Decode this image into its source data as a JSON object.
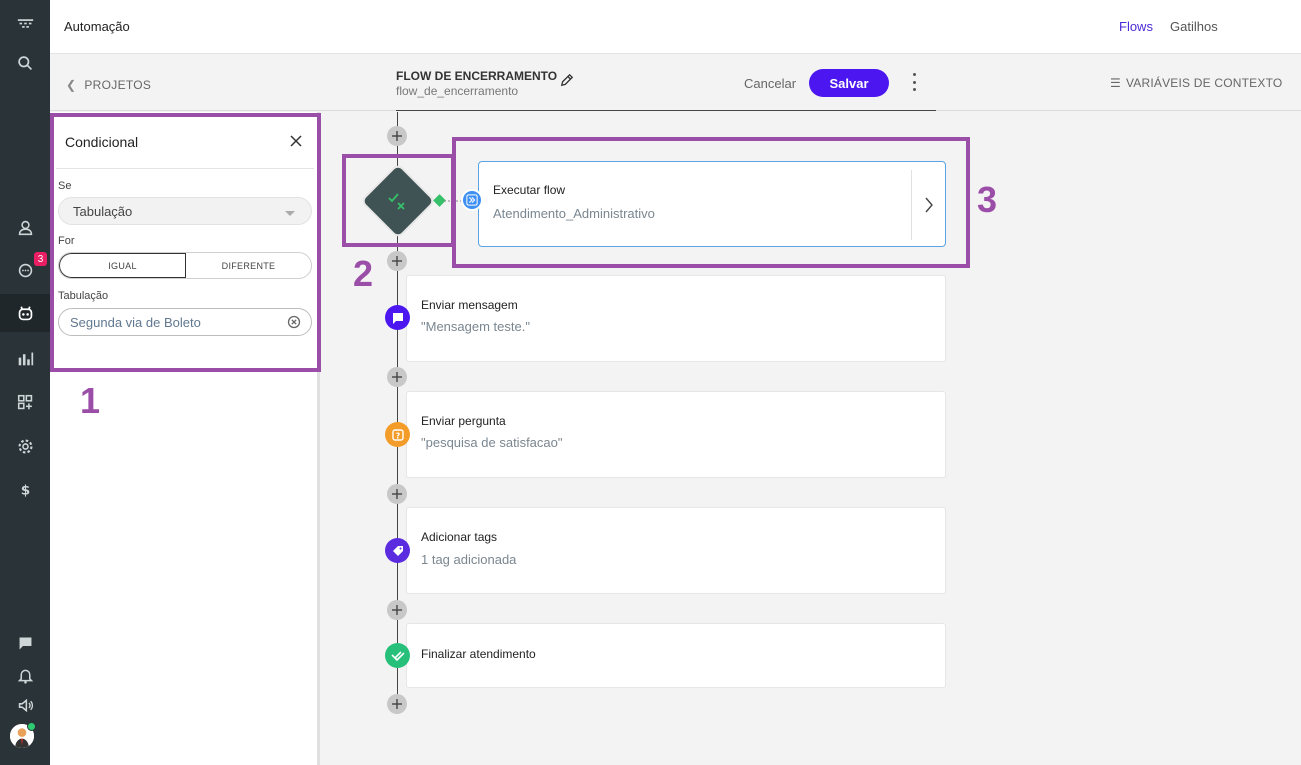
{
  "rail": {
    "badge_count": "3"
  },
  "topbar": {
    "app_title": "Automação",
    "nav_flows": "Flows",
    "nav_gatilhos": "Gatilhos"
  },
  "subbar": {
    "back_label": "PROJETOS",
    "flow_name": "FLOW DE ENCERRAMENTO",
    "flow_slug": "flow_de_encerramento",
    "cancel_label": "Cancelar",
    "save_label": "Salvar",
    "context_vars_label": "VARIÁVEIS DE CONTEXTO"
  },
  "panel": {
    "title": "Condicional",
    "se_label": "Se",
    "se_value": "Tabulação",
    "for_label": "For",
    "option_igual": "IGUAL",
    "option_diferente": "DIFERENTE",
    "tab_label": "Tabulação",
    "tab_value": "Segunda via de Boleto"
  },
  "annotations": {
    "n1": "1",
    "n2": "2",
    "n3": "3"
  },
  "flow": {
    "exec": {
      "title": "Executar flow",
      "sub": "Atendimento_Administrativo"
    },
    "msg": {
      "title": "Enviar mensagem",
      "sub": "\"Mensagem teste.\""
    },
    "question": {
      "title": "Enviar pergunta",
      "sub": "\"pesquisa de satisfacao\""
    },
    "tags": {
      "title": "Adicionar tags",
      "sub": "1 tag adicionada"
    },
    "finish": {
      "title": "Finalizar atendimento"
    }
  },
  "colors": {
    "accent": "#4b16f0",
    "annotation": "#9b4ea8",
    "msg_icon": "#4b16f0",
    "question_icon": "#f39c2a",
    "tags_icon": "#5b2be0",
    "finish_icon": "#27c07a"
  }
}
